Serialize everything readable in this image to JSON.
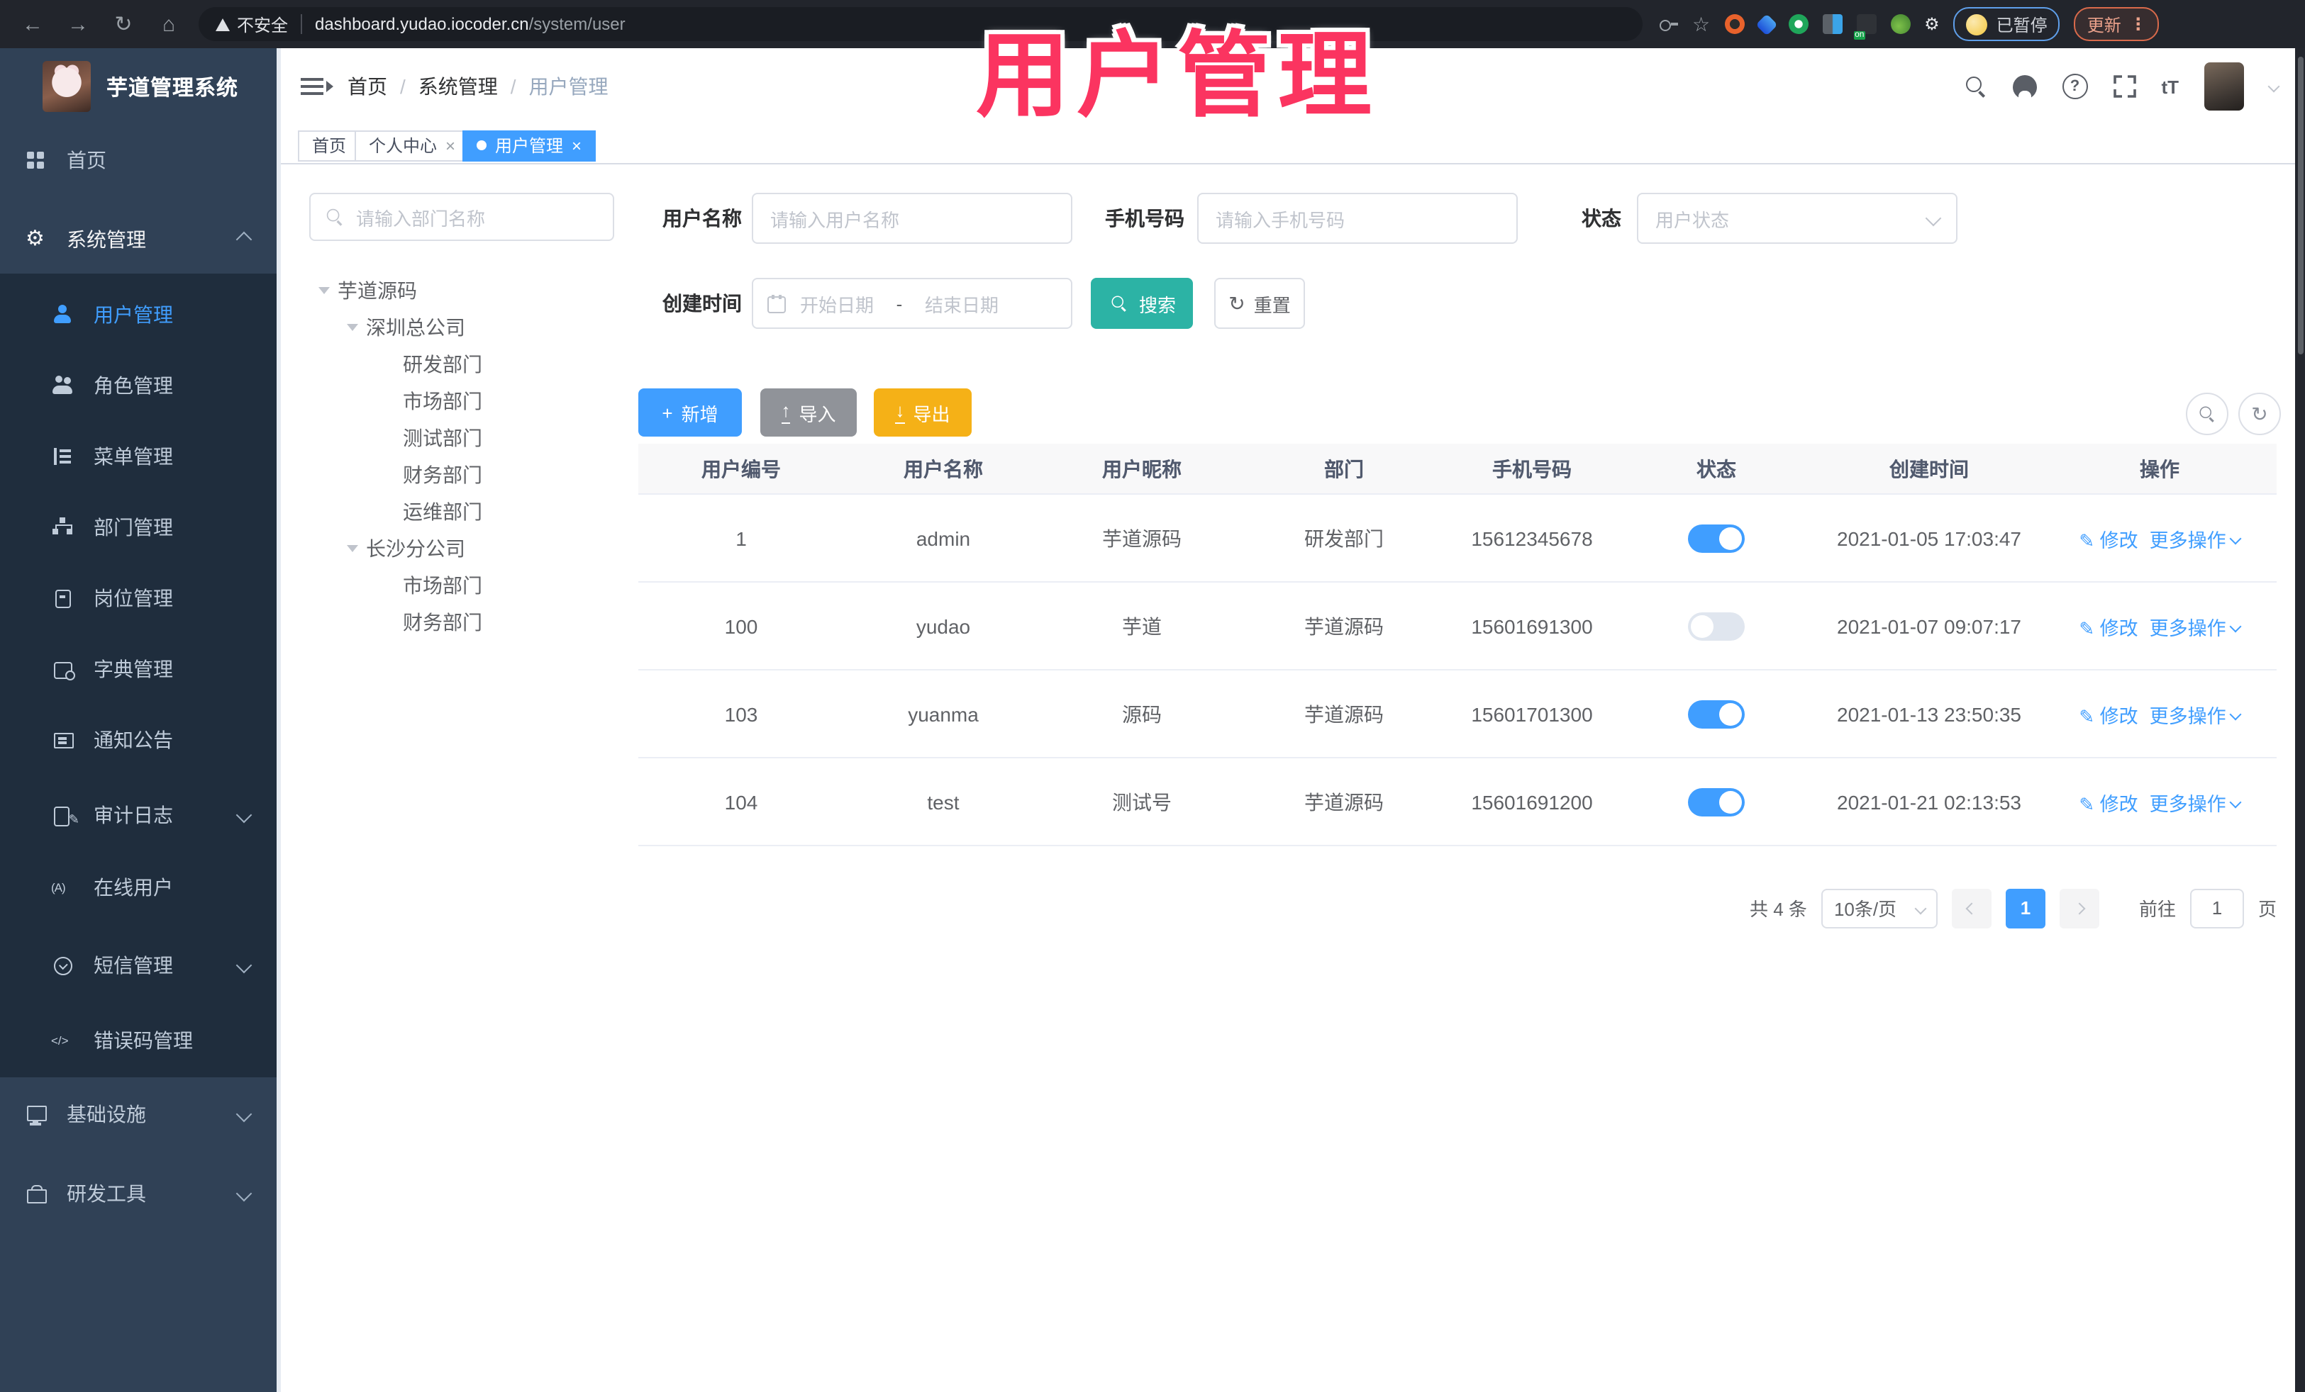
{
  "browser": {
    "security_label": "不安全",
    "url_host": "dashboard.yudao.iocoder.cn",
    "url_path": "/system/user",
    "profile_status": "已暂停",
    "update_label": "更新"
  },
  "overlay": {
    "title": "用户管理"
  },
  "sidebar": {
    "logo_title": "芋道管理系统",
    "items": [
      {
        "label": "首页"
      },
      {
        "label": "系统管理"
      },
      {
        "label": "用户管理"
      },
      {
        "label": "角色管理"
      },
      {
        "label": "菜单管理"
      },
      {
        "label": "部门管理"
      },
      {
        "label": "岗位管理"
      },
      {
        "label": "字典管理"
      },
      {
        "label": "通知公告"
      },
      {
        "label": "审计日志"
      },
      {
        "label": "在线用户"
      },
      {
        "label": "短信管理"
      },
      {
        "label": "错误码管理"
      },
      {
        "label": "基础设施"
      },
      {
        "label": "研发工具"
      }
    ]
  },
  "breadcrumb": [
    "首页",
    "系统管理",
    "用户管理"
  ],
  "tabs": [
    {
      "label": "首页"
    },
    {
      "label": "个人中心"
    },
    {
      "label": "用户管理"
    }
  ],
  "dept": {
    "search_placeholder": "请输入部门名称",
    "tree": [
      {
        "label": "芋道源码"
      },
      {
        "label": "深圳总公司"
      },
      {
        "label": "研发部门"
      },
      {
        "label": "市场部门"
      },
      {
        "label": "测试部门"
      },
      {
        "label": "财务部门"
      },
      {
        "label": "运维部门"
      },
      {
        "label": "长沙分公司"
      },
      {
        "label": "市场部门"
      },
      {
        "label": "财务部门"
      }
    ]
  },
  "filters": {
    "username_label": "用户名称",
    "username_placeholder": "请输入用户名称",
    "mobile_label": "手机号码",
    "mobile_placeholder": "请输入手机号码",
    "status_label": "状态",
    "status_placeholder": "用户状态",
    "created_label": "创建时间",
    "date_start_placeholder": "开始日期",
    "date_separator": "-",
    "date_end_placeholder": "结束日期",
    "search_label": "搜索",
    "reset_label": "重置"
  },
  "toolbar": {
    "add_label": "新增",
    "import_label": "导入",
    "export_label": "导出"
  },
  "table": {
    "columns": [
      "用户编号",
      "用户名称",
      "用户昵称",
      "部门",
      "手机号码",
      "状态",
      "创建时间",
      "操作"
    ],
    "action_edit_label": "修改",
    "action_more_label": "更多操作",
    "rows": [
      {
        "id": "1",
        "username": "admin",
        "nickname": "芋道源码",
        "dept": "研发部门",
        "mobile": "15612345678",
        "status": "on",
        "created": "2021-01-05 17:03:47"
      },
      {
        "id": "100",
        "username": "yudao",
        "nickname": "芋道",
        "dept": "芋道源码",
        "mobile": "15601691300",
        "status": "off",
        "created": "2021-01-07 09:07:17"
      },
      {
        "id": "103",
        "username": "yuanma",
        "nickname": "源码",
        "dept": "芋道源码",
        "mobile": "15601701300",
        "status": "on",
        "created": "2021-01-13 23:50:35"
      },
      {
        "id": "104",
        "username": "test",
        "nickname": "测试号",
        "dept": "芋道源码",
        "mobile": "15601691200",
        "status": "on",
        "created": "2021-01-21 02:13:53"
      }
    ]
  },
  "pagination": {
    "total_label": "共 4 条",
    "page_size_label": "10条/页",
    "current_page": "1",
    "goto_label": "前往",
    "goto_value": "1",
    "page_unit_label": "页"
  },
  "colors": {
    "primary": "#409eff",
    "search_teal": "#2cb3a5",
    "export_gold": "#f5b117",
    "import_gray": "#909399",
    "overlay_pink": "#fb3460",
    "sidebar_bg": "#304156",
    "submenu_bg": "#1f2d3d"
  }
}
